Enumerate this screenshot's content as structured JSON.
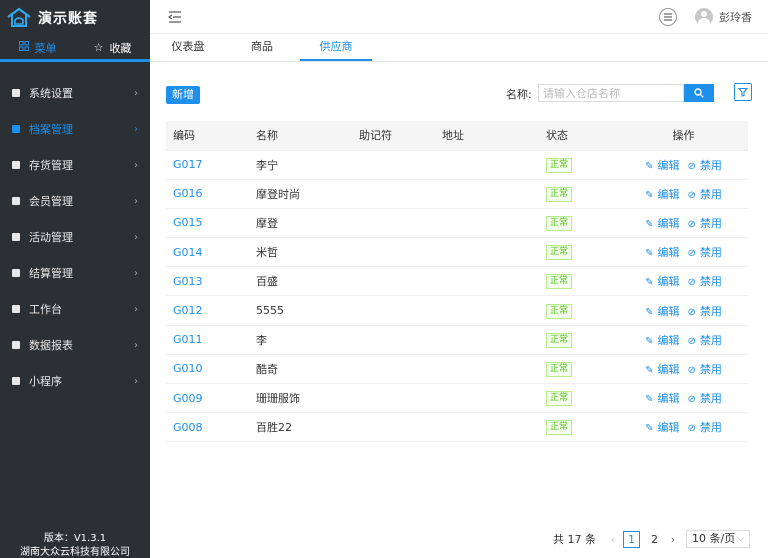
{
  "app": {
    "name": "演示账套",
    "version": "版本：V1.3.1",
    "company": "湖南大众云科技有限公司"
  },
  "sidebar": {
    "tabs": [
      {
        "label": "菜单",
        "icon": "grid-icon",
        "active": true
      },
      {
        "label": "收藏",
        "icon": "star-icon",
        "active": false
      }
    ],
    "items": [
      {
        "label": "系统设置",
        "icon": "settings-icon",
        "active": false
      },
      {
        "label": "档案管理",
        "icon": "archive-icon",
        "active": true
      },
      {
        "label": "存货管理",
        "icon": "inventory-icon",
        "active": false
      },
      {
        "label": "会员管理",
        "icon": "member-icon",
        "active": false
      },
      {
        "label": "活动管理",
        "icon": "gift-icon",
        "active": false
      },
      {
        "label": "结算管理",
        "icon": "settlement-icon",
        "active": false
      },
      {
        "label": "工作台",
        "icon": "workbench-icon",
        "active": false
      },
      {
        "label": "数据报表",
        "icon": "report-icon",
        "active": false
      },
      {
        "label": "小程序",
        "icon": "miniapp-icon",
        "active": false
      }
    ]
  },
  "header": {
    "username": "彭玲香"
  },
  "tabs": [
    {
      "label": "仪表盘",
      "active": false
    },
    {
      "label": "商品",
      "active": false
    },
    {
      "label": "供应商",
      "active": true
    }
  ],
  "toolbar": {
    "add_label": "新增",
    "search_label": "名称:",
    "search_placeholder": "请输入仓店名称"
  },
  "table": {
    "columns": [
      "编码",
      "名称",
      "助记符",
      "地址",
      "状态",
      "操作"
    ],
    "rows": [
      {
        "code": "G017",
        "name": "李宁",
        "mnemonic": "",
        "address": "",
        "status": "正常"
      },
      {
        "code": "G016",
        "name": "摩登时尚",
        "mnemonic": "",
        "address": "",
        "status": "正常"
      },
      {
        "code": "G015",
        "name": "摩登",
        "mnemonic": "",
        "address": "",
        "status": "正常"
      },
      {
        "code": "G014",
        "name": "米哲",
        "mnemonic": "",
        "address": "",
        "status": "正常"
      },
      {
        "code": "G013",
        "name": "百盛",
        "mnemonic": "",
        "address": "",
        "status": "正常"
      },
      {
        "code": "G012",
        "name": "5555",
        "mnemonic": "",
        "address": "",
        "status": "正常"
      },
      {
        "code": "G011",
        "name": "李",
        "mnemonic": "",
        "address": "",
        "status": "正常"
      },
      {
        "code": "G010",
        "name": "酷奇",
        "mnemonic": "",
        "address": "",
        "status": "正常"
      },
      {
        "code": "G009",
        "name": "珊珊服饰",
        "mnemonic": "",
        "address": "",
        "status": "正常"
      },
      {
        "code": "G008",
        "name": "百胜22",
        "mnemonic": "",
        "address": "",
        "status": "正常"
      }
    ],
    "edit_label": "编辑",
    "disable_label": "禁用"
  },
  "pagination": {
    "total": "共 17 条",
    "pages": [
      "1",
      "2"
    ],
    "current": "1",
    "page_size": "10 条/页"
  },
  "colors": {
    "primary": "#1e8fea",
    "sidebar_bg": "#2b3035",
    "status_green": "#52c41a"
  }
}
